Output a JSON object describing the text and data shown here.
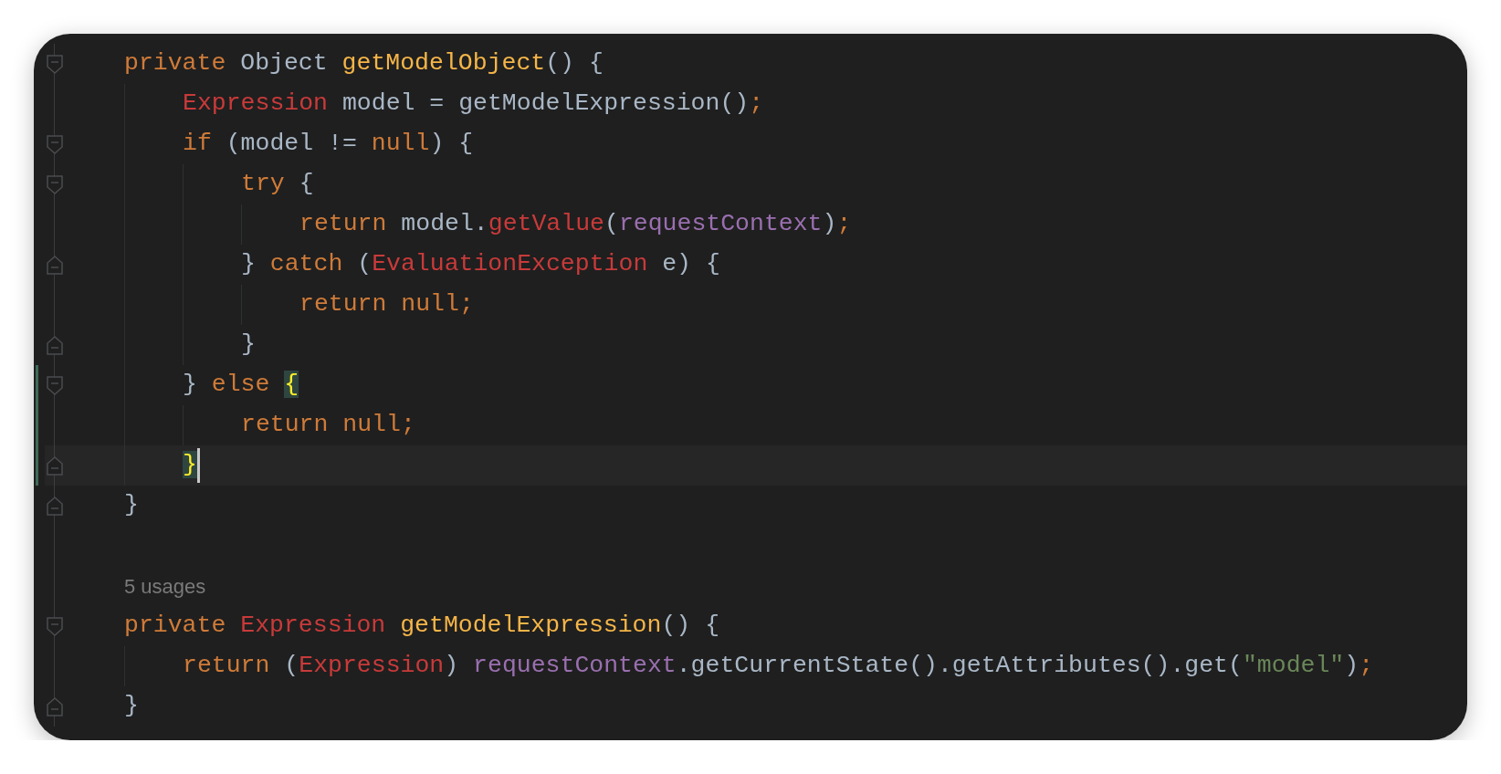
{
  "editor": {
    "lines": [
      {
        "kind": "code",
        "fold_start": true,
        "fold_end": false,
        "changed": false,
        "current": false,
        "caret": false,
        "tokens": [
          {
            "kind": "keyword",
            "text": "private "
          },
          {
            "kind": "plain",
            "text": "Object "
          },
          {
            "kind": "decl",
            "text": "getModelObject"
          },
          {
            "kind": "plain",
            "text": "() {"
          }
        ]
      },
      {
        "kind": "code",
        "fold_start": false,
        "fold_end": false,
        "changed": false,
        "current": false,
        "caret": false,
        "tokens": [
          {
            "kind": "type",
            "text": "    Expression "
          },
          {
            "kind": "plain",
            "text": "model = getModelExpression()"
          },
          {
            "kind": "keyword",
            "text": ";"
          }
        ]
      },
      {
        "kind": "code",
        "fold_start": true,
        "fold_end": false,
        "changed": false,
        "current": false,
        "caret": false,
        "tokens": [
          {
            "kind": "keyword",
            "text": "    if "
          },
          {
            "kind": "plain",
            "text": "(model != "
          },
          {
            "kind": "keyword",
            "text": "null"
          },
          {
            "kind": "plain",
            "text": ") {"
          }
        ]
      },
      {
        "kind": "code",
        "fold_start": true,
        "fold_end": false,
        "changed": false,
        "current": false,
        "caret": false,
        "tokens": [
          {
            "kind": "keyword",
            "text": "        try "
          },
          {
            "kind": "plain",
            "text": "{"
          }
        ]
      },
      {
        "kind": "code",
        "fold_start": false,
        "fold_end": false,
        "changed": false,
        "current": false,
        "caret": false,
        "tokens": [
          {
            "kind": "keyword",
            "text": "            return "
          },
          {
            "kind": "plain",
            "text": "model."
          },
          {
            "kind": "type",
            "text": "getValue"
          },
          {
            "kind": "plain",
            "text": "("
          },
          {
            "kind": "field",
            "text": "requestContext"
          },
          {
            "kind": "plain",
            "text": ")"
          },
          {
            "kind": "keyword",
            "text": ";"
          }
        ]
      },
      {
        "kind": "code",
        "fold_start": false,
        "fold_end": true,
        "changed": false,
        "current": false,
        "caret": false,
        "tokens": [
          {
            "kind": "plain",
            "text": "        } "
          },
          {
            "kind": "keyword",
            "text": "catch "
          },
          {
            "kind": "plain",
            "text": "("
          },
          {
            "kind": "type",
            "text": "EvaluationException "
          },
          {
            "kind": "plain",
            "text": "e) {"
          }
        ]
      },
      {
        "kind": "code",
        "fold_start": false,
        "fold_end": false,
        "changed": false,
        "current": false,
        "caret": false,
        "tokens": [
          {
            "kind": "keyword",
            "text": "            return null;"
          }
        ]
      },
      {
        "kind": "code",
        "fold_start": false,
        "fold_end": true,
        "changed": false,
        "current": false,
        "caret": false,
        "tokens": [
          {
            "kind": "plain",
            "text": "        }"
          }
        ]
      },
      {
        "kind": "code",
        "fold_start": true,
        "fold_end": false,
        "changed": true,
        "current": false,
        "caret": false,
        "tokens": [
          {
            "kind": "plain",
            "text": "    } "
          },
          {
            "kind": "keyword",
            "text": "else "
          },
          {
            "kind": "match",
            "text": "{"
          }
        ]
      },
      {
        "kind": "code",
        "fold_start": false,
        "fold_end": false,
        "changed": true,
        "current": false,
        "caret": false,
        "tokens": [
          {
            "kind": "keyword",
            "text": "        return null;"
          }
        ]
      },
      {
        "kind": "code",
        "fold_start": false,
        "fold_end": true,
        "changed": true,
        "current": true,
        "caret": true,
        "tokens": [
          {
            "kind": "match",
            "text": "    }"
          }
        ]
      },
      {
        "kind": "code",
        "fold_start": false,
        "fold_end": true,
        "changed": false,
        "current": false,
        "caret": false,
        "tokens": [
          {
            "kind": "plain",
            "text": "}"
          }
        ]
      },
      {
        "kind": "blank",
        "fold_start": false,
        "fold_end": false,
        "changed": false,
        "current": false,
        "caret": false
      },
      {
        "kind": "hint",
        "fold_start": false,
        "fold_end": false,
        "changed": false,
        "current": false,
        "caret": false,
        "text": "5 usages"
      },
      {
        "kind": "code",
        "fold_start": true,
        "fold_end": false,
        "changed": false,
        "current": false,
        "caret": false,
        "tokens": [
          {
            "kind": "keyword",
            "text": "private "
          },
          {
            "kind": "type",
            "text": "Expression "
          },
          {
            "kind": "decl",
            "text": "getModelExpression"
          },
          {
            "kind": "plain",
            "text": "() {"
          }
        ]
      },
      {
        "kind": "code",
        "fold_start": false,
        "fold_end": false,
        "changed": false,
        "current": false,
        "caret": false,
        "tokens": [
          {
            "kind": "keyword",
            "text": "    return "
          },
          {
            "kind": "plain",
            "text": "("
          },
          {
            "kind": "type",
            "text": "Expression"
          },
          {
            "kind": "plain",
            "text": ") "
          },
          {
            "kind": "field",
            "text": "requestContext"
          },
          {
            "kind": "plain",
            "text": ".getCurrentState().getAttributes().get("
          },
          {
            "kind": "string",
            "text": "\"model\""
          },
          {
            "kind": "plain",
            "text": ")"
          },
          {
            "kind": "keyword",
            "text": ";"
          }
        ]
      },
      {
        "kind": "code",
        "fold_start": false,
        "fold_end": true,
        "changed": false,
        "current": false,
        "caret": false,
        "tokens": [
          {
            "kind": "plain",
            "text": "}"
          }
        ]
      }
    ]
  }
}
